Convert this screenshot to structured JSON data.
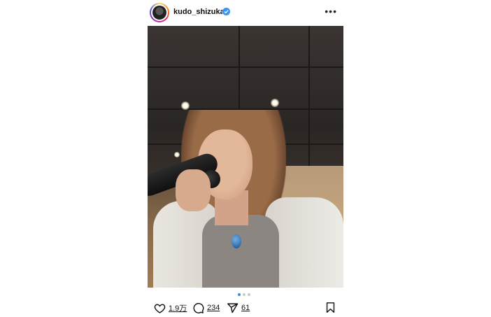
{
  "post": {
    "username": "kudo_shizuka",
    "verified": true,
    "more_icon": "more-horizontal-icon",
    "avatar_icon": "profile-avatar"
  },
  "carousel": {
    "total": 3,
    "active_index": 0,
    "active_color": "#3d8ae6",
    "inactive_color": "#c8c8c8"
  },
  "actions": {
    "likes": "1.9万",
    "comments": "234",
    "shares": "61",
    "icons": [
      "heart-icon",
      "comment-icon",
      "send-icon",
      "bookmark-icon"
    ]
  },
  "colors": {
    "verified_badge": "#3897f0",
    "avatar_gradient": [
      "#feda75",
      "#fa7e1e",
      "#d62976",
      "#962fbf",
      "#4f5bd5"
    ]
  }
}
